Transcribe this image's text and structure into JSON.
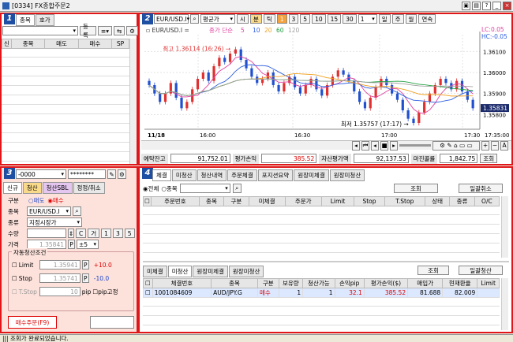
{
  "window": {
    "title": "[0334] FX종합주문2"
  },
  "panel1": {
    "badge": "1",
    "tabs": [
      "종목",
      "호가"
    ],
    "register_label": "등록",
    "columns": [
      "신",
      "종목",
      "매도",
      "매수",
      "SP"
    ]
  },
  "panel2": {
    "badge": "2",
    "symbol": "EUR/USD.I",
    "chart_type": "평균가",
    "mode_buttons": [
      "시",
      "분",
      "틱"
    ],
    "interval_buttons": [
      "1",
      "3",
      "5",
      "10",
      "15",
      "30"
    ],
    "interval_value": "1",
    "period_buttons": [
      "일",
      "주",
      "월"
    ],
    "continuous_label": "연속",
    "legend_symbol": "EUR/USD.I",
    "legend_ma_label": "종가 단순",
    "legend_ma": [
      "5",
      "10",
      "20",
      "60",
      "120"
    ],
    "lc_label": "LC:0.05",
    "hc_label": "HC:-0.05",
    "high_label": "최고 1.36114 (16:26)",
    "low_label": "최저 1.35757 (17:17)",
    "current_price": "1.35831",
    "y_ticks": [
      "1.36100",
      "1.36000",
      "1.35900",
      "1.35800"
    ],
    "x_ticks": [
      "11/18",
      "16:00",
      "16:30",
      "17:00",
      "17:30",
      "17:35:00"
    ],
    "summary": {
      "deposit_label": "예탁잔고",
      "deposit_value": "91,752.01",
      "pnl_label": "평가손익",
      "pnl_value": "385.52",
      "asset_label": "자산평가액",
      "asset_value": "92,137.53",
      "margin_label": "마진콜률",
      "margin_value": "1,842.75",
      "query_label": "조회"
    }
  },
  "panel3": {
    "badge": "3",
    "account": "-0000",
    "password": "********",
    "tabs": [
      "신규",
      "청산",
      "청산SBL",
      "정정/취소"
    ],
    "side_label": "구분",
    "sell_label": "매도",
    "buy_label": "매수",
    "symbol_label": "종목",
    "symbol_value": "EUR/USD.I",
    "type_label": "종류",
    "type_value": "지정시장가",
    "qty_label": "수량",
    "qty_buttons": [
      "C",
      "거",
      "1",
      "3",
      "5"
    ],
    "price_label": "가격",
    "price_value": "1.35841",
    "price_slip": "±5",
    "auto_label": "자동청산조건",
    "limit_label": "Limit",
    "limit_value": "1.35941",
    "limit_offset": "+10.0",
    "stop_label": "Stop",
    "stop_value": "1.35741",
    "stop_offset": "-10.0",
    "tstop_label": "T.Stop",
    "tstop_value": "10",
    "pip_label": "pip",
    "pip_fixed_label": "pip고정",
    "order_button": "매수주문(F9)"
  },
  "panel4": {
    "badge": "4",
    "tabs": [
      "체결",
      "미청산",
      "청산내역",
      "주문체결",
      "포지션요약",
      "원장미체결",
      "원장미청산"
    ],
    "filter_all": "전체",
    "filter_symbol": "종목",
    "query_label": "조회",
    "cancel_all_label": "일괄취소",
    "order_columns": [
      "주문번호",
      "종목",
      "구분",
      "미체결",
      "주문가",
      "Limit",
      "Stop",
      "T.Stop",
      "상태",
      "종류",
      "O/C"
    ],
    "lower_tabs": [
      "미체결",
      "미청산",
      "원장미체결",
      "원장미청산"
    ],
    "query2_label": "조회",
    "close_all_label": "일괄청산",
    "pos_columns": [
      "체결번호",
      "종목",
      "구분",
      "보유량",
      "청산가능",
      "손익pip",
      "평가손익($)",
      "매입가",
      "현재환율",
      "Limit"
    ],
    "pos_rows": [
      [
        "1001084609",
        "AUD/JPY.G",
        "매수",
        "1",
        "1",
        "32.1",
        "385.52",
        "81.688",
        "82.009",
        ""
      ]
    ]
  },
  "status": {
    "message": "조회가 완료되었습니다."
  },
  "chart_data": {
    "type": "candlestick",
    "x": [
      "11/18",
      "16:00",
      "16:30",
      "17:00",
      "17:30",
      "17:35:00"
    ],
    "y_ticks": [
      1.361,
      1.36,
      1.359,
      1.358
    ],
    "ylim": [
      1.3573,
      1.3618
    ],
    "high": 1.36114,
    "low": 1.35757,
    "last": 1.35831,
    "close_series": [
      1.3594,
      1.359,
      1.3586,
      1.359,
      1.3595,
      1.3588,
      1.3583,
      1.3586,
      1.3592,
      1.3597,
      1.36,
      1.3596,
      1.3603,
      1.3607,
      1.3605,
      1.3609,
      1.3611,
      1.3606,
      1.3602,
      1.3598,
      1.3595,
      1.3597,
      1.36,
      1.3594,
      1.3591,
      1.3595,
      1.3598,
      1.3593,
      1.359,
      1.3594,
      1.3597,
      1.3592,
      1.3589,
      1.3594,
      1.3598,
      1.3601,
      1.3599,
      1.3596,
      1.3591,
      1.3586,
      1.3583,
      1.3588,
      1.3593,
      1.3597,
      1.3594,
      1.359,
      1.3587,
      1.3582,
      1.3578,
      1.3576,
      1.3581,
      1.3586,
      1.359,
      1.3594,
      1.3597,
      1.3595,
      1.3592,
      1.3596,
      1.3591,
      1.3587,
      1.3583
    ]
  }
}
